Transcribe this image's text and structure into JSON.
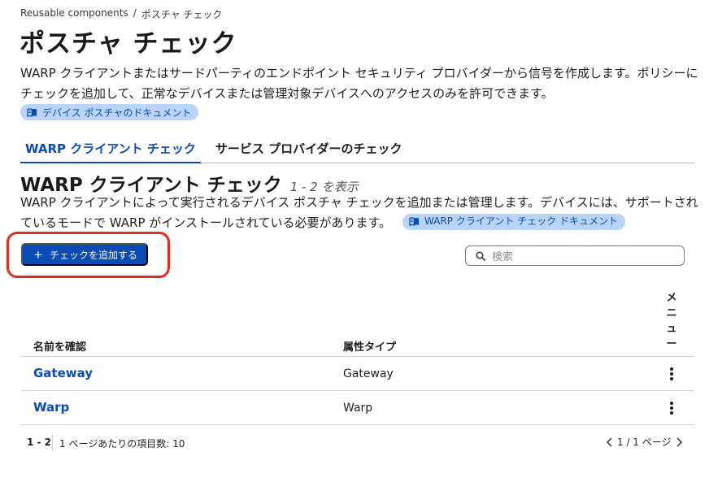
{
  "breadcrumb": {
    "parent": "Reusable components",
    "separator": "/",
    "current": "ポスチャ チェック"
  },
  "page": {
    "title": "ポスチャ チェック",
    "description": "WARP クライアントまたはサードパーティのエンドポイント セキュリティ プロバイダーから信号を作成します。ポリシーにチェックを追加して、正常なデバイスまたは管理対象デバイスへのアクセスのみを許可できます。",
    "doc_link": "デバイス ポスチャのドキュメント"
  },
  "tabs": [
    {
      "label": "WARP クライアント チェック",
      "active": true
    },
    {
      "label": "サービス プロバイダーのチェック",
      "active": false
    }
  ],
  "section": {
    "title": "WARP クライアント チェック",
    "count": "1 - 2 を表示",
    "description": "WARP クライアントによって実行されるデバイス ポスチャ チェックを追加または管理します。デバイスには、サポートされているモードで WARP がインストールされている必要があります。",
    "doc_link": "WARP クライアント チェック ドキュメント"
  },
  "toolbar": {
    "add_label": "チェックを追加する",
    "search_placeholder": "検索"
  },
  "table": {
    "headers": {
      "name": "名前を確認",
      "type": "属性タイプ",
      "menu": "メニュー"
    },
    "rows": [
      {
        "name": "Gateway",
        "type": "Gateway"
      },
      {
        "name": "Warp",
        "type": "Warp"
      }
    ]
  },
  "pagination": {
    "range": "1 - 2",
    "per_page": "1 ページあたりの項目数: 10",
    "page": "1 / 1 ページ"
  },
  "colors": {
    "accent": "#0a4bb5",
    "highlight": "#e8291c",
    "pill_bg": "#b8d4f8"
  },
  "icons": [
    "book-icon",
    "plus-icon",
    "search-icon",
    "kebab-menu-icon",
    "chevron-left-icon",
    "chevron-right-icon"
  ]
}
